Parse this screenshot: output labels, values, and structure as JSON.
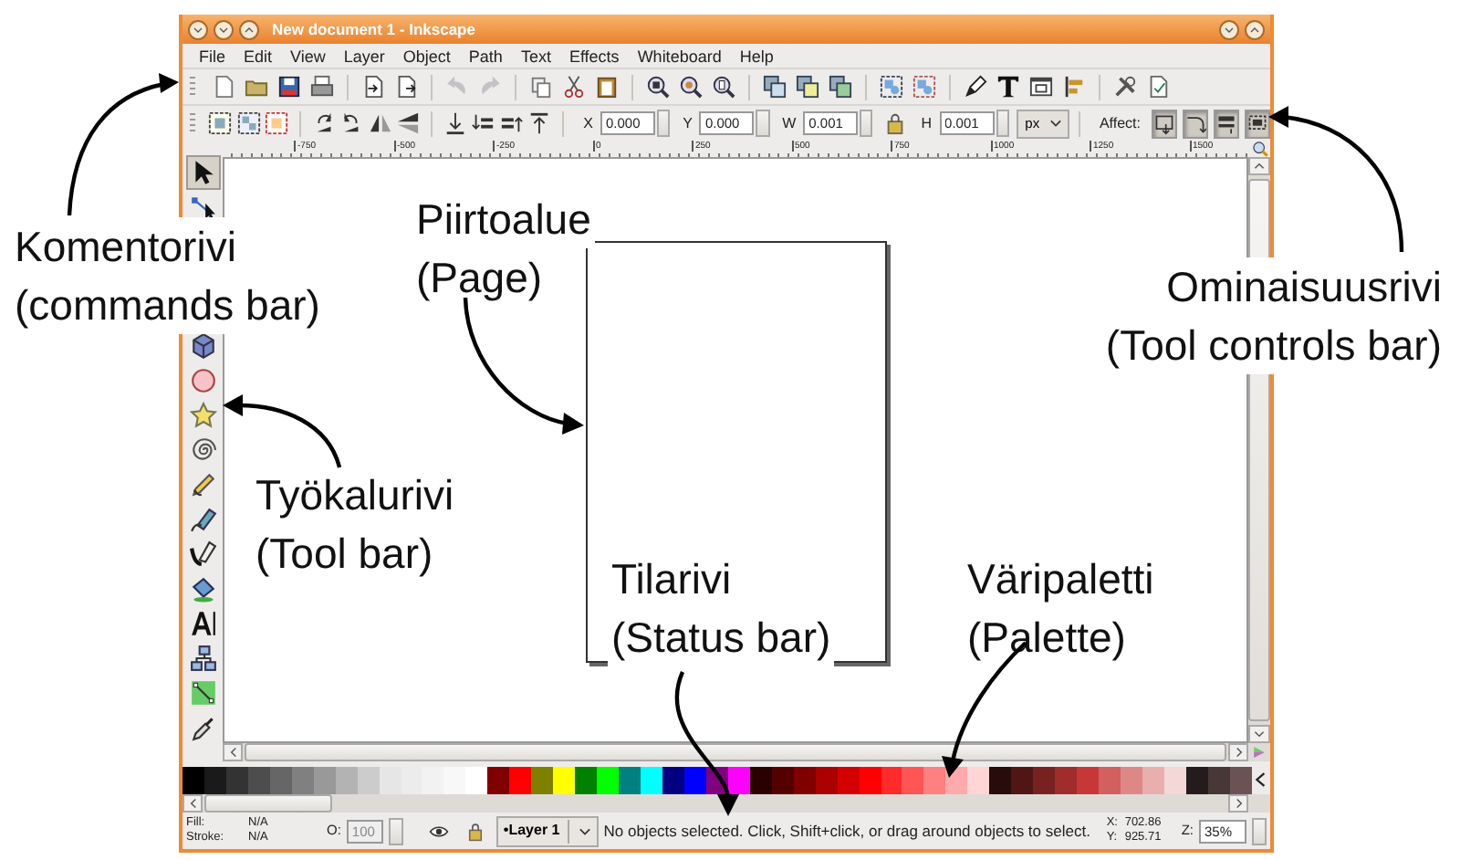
{
  "window": {
    "title": "New document 1 - Inkscape"
  },
  "menu": [
    "File",
    "Edit",
    "View",
    "Layer",
    "Object",
    "Path",
    "Text",
    "Effects",
    "Whiteboard",
    "Help"
  ],
  "commands_bar": [
    [
      {
        "disabled": false
      },
      {
        "disabled": false
      },
      {
        "disabled": false
      },
      {
        "disabled": false
      }
    ],
    [
      {
        "disabled": false
      },
      {
        "disabled": false
      }
    ],
    [
      {
        "disabled": true
      },
      {
        "disabled": true
      }
    ],
    [
      {
        "disabled": false
      },
      {
        "disabled": false
      },
      {
        "disabled": false
      }
    ],
    [
      {
        "disabled": false
      },
      {
        "disabled": false
      },
      {
        "disabled": false
      }
    ],
    [
      {
        "disabled": false
      },
      {
        "disabled": false
      },
      {
        "disabled": false
      }
    ],
    [
      {
        "disabled": false
      },
      {
        "disabled": false
      }
    ],
    [
      {
        "disabled": false
      },
      {
        "disabled": false
      },
      {
        "disabled": false
      },
      {
        "disabled": false
      }
    ],
    [
      {
        "disabled": false
      },
      {
        "disabled": false
      }
    ]
  ],
  "tool_controls": {
    "fields": [
      {
        "label": "X",
        "value": "0.000"
      },
      {
        "label": "Y",
        "value": "0.000"
      },
      {
        "label": "W",
        "value": "0.001"
      },
      {
        "label": "H",
        "value": "0.001"
      }
    ],
    "unit": "px",
    "affect_label": "Affect:",
    "affect_buttons": [
      {
        "selected": true
      },
      {
        "selected": true
      },
      {
        "selected": true
      },
      {
        "selected": true
      }
    ]
  },
  "ruler": [
    "-750",
    "-500",
    "-250",
    "0",
    "250",
    "500",
    "750",
    "1000",
    "1250",
    "1500"
  ],
  "tools": [
    {
      "selected": true
    },
    {
      "selected": false
    },
    {
      "selected": false
    },
    {
      "selected": false
    },
    {
      "selected": false
    },
    {
      "selected": false
    },
    {
      "selected": false
    },
    {
      "selected": false
    },
    {
      "selected": false
    },
    {
      "selected": false
    },
    {
      "selected": false
    },
    {
      "selected": false
    },
    {
      "selected": false
    },
    {
      "selected": false
    }
  ],
  "palette": [
    {
      "color": "#000000"
    },
    {
      "color": "#1a1a1a"
    },
    {
      "color": "#333333"
    },
    {
      "color": "#4d4d4d"
    },
    {
      "color": "#666666"
    },
    {
      "color": "#808080"
    },
    {
      "color": "#999999"
    },
    {
      "color": "#b3b3b3"
    },
    {
      "color": "#cccccc"
    },
    {
      "color": "#e6e6e6"
    },
    {
      "color": "#ececec"
    },
    {
      "color": "#f2f2f2"
    },
    {
      "color": "#f8f8f8"
    },
    {
      "color": "#ffffff"
    },
    {
      "color": "#800000"
    },
    {
      "color": "#ff0000"
    },
    {
      "color": "#808000"
    },
    {
      "color": "#ffff00"
    },
    {
      "color": "#008000"
    },
    {
      "color": "#00ff00"
    },
    {
      "color": "#008080"
    },
    {
      "color": "#00ffff"
    },
    {
      "color": "#000080"
    },
    {
      "color": "#0000ff"
    },
    {
      "color": "#800080"
    },
    {
      "color": "#ff00ff"
    },
    {
      "color": "#2b0000"
    },
    {
      "color": "#550000"
    },
    {
      "color": "#800000"
    },
    {
      "color": "#aa0000"
    },
    {
      "color": "#d40000"
    },
    {
      "color": "#ff0000"
    },
    {
      "color": "#ff2a2a"
    },
    {
      "color": "#ff5555"
    },
    {
      "color": "#ff8080"
    },
    {
      "color": "#ffaaaa"
    },
    {
      "color": "#ffd5d5"
    },
    {
      "color": "#280b0b"
    },
    {
      "color": "#501616"
    },
    {
      "color": "#782121"
    },
    {
      "color": "#a02c2c"
    },
    {
      "color": "#c83737"
    },
    {
      "color": "#d35f5f"
    },
    {
      "color": "#de8787"
    },
    {
      "color": "#e9afaf"
    },
    {
      "color": "#f4d7d7"
    },
    {
      "color": "#241c1c"
    },
    {
      "color": "#483737"
    },
    {
      "color": "#6c5353"
    }
  ],
  "status_bar": {
    "fill_label": "Fill:",
    "fill_value": "N/A",
    "stroke_label": "Stroke:",
    "stroke_value": "N/A",
    "opacity": {
      "label": "O:",
      "value": "100",
      "disabled": true
    },
    "layer": "•Layer 1",
    "message": "No objects selected. Click, Shift+click, or drag around objects to select.",
    "x_label": "X:",
    "x_value": "702.86",
    "y_label": "Y:",
    "y_value": "925.71",
    "zoom_label": "Z:",
    "zoom_value": "35%"
  },
  "annotations": [
    {
      "title": "Komentorivi",
      "subtitle": "(commands bar)"
    },
    {
      "title": "Piirtoalue",
      "subtitle": "(Page)"
    },
    {
      "title": "Ominaisuusrivi",
      "subtitle": "(Tool controls bar)"
    },
    {
      "title": "Työkalurivi",
      "subtitle": "(Tool bar)"
    },
    {
      "title": "Tilarivi",
      "subtitle": "(Status bar)"
    },
    {
      "title": "Väripaletti",
      "subtitle": "(Palette)"
    }
  ]
}
